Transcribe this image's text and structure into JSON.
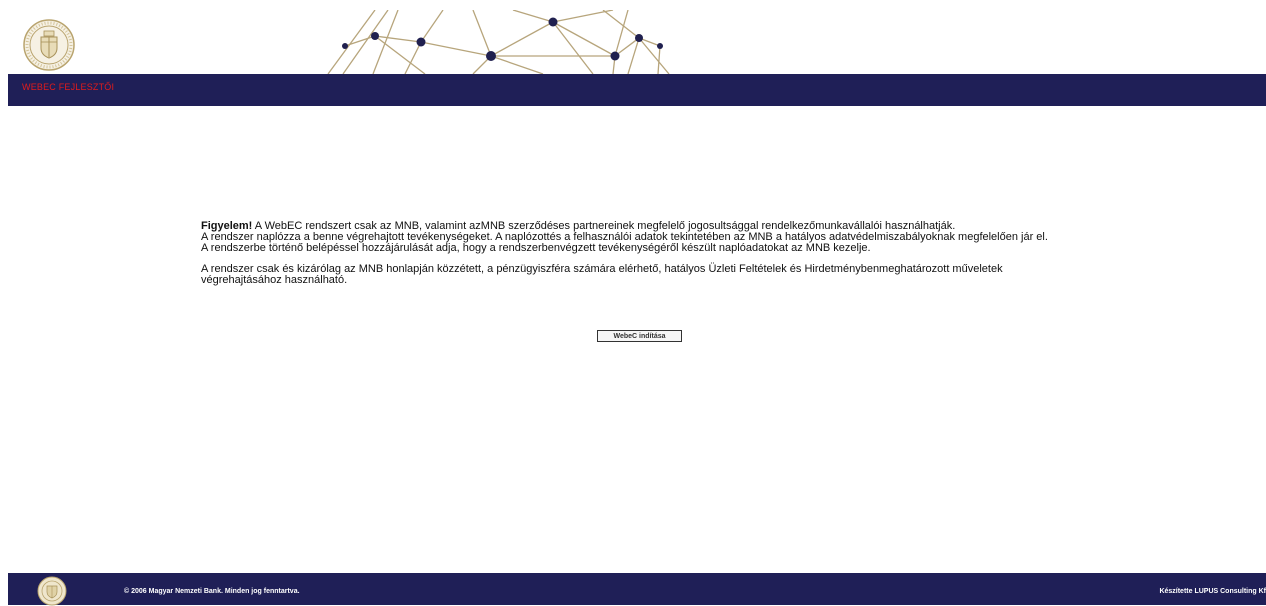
{
  "header": {
    "logo_icon": "mnb-seal-icon",
    "decoration_icon": "network-graph-icon"
  },
  "nav": {
    "title": "WEBEC FEJLESZTŐI",
    "title_color": "#e21b1b",
    "bar_color": "#1f1f57"
  },
  "notice": {
    "lead": "Figyelem!",
    "line1": " A WebEC rendszert csak az MNB, valamint azMNB szerződéses partnereinek megfelelő jogosultsággal rendelkezőmunkavállalói használhatják.",
    "line2": "A rendszer naplózza a benne végrehajtott tevékenységeket. A naplózottés a felhasználói adatok tekintetében az MNB a hatályos adatvédelmiszabályoknak megfelelően jár el.",
    "line3": "A rendszerbe történő belépéssel hozzájárulását adja, hogy a rendszerbenvégzett tevékenységéről készült naplóadatokat az MNB kezelje.",
    "line4": "A rendszer csak és kizárólag az MNB honlapján közzétett, a pénzügyiszféra számára elérhető, hatályos Üzleti Feltételek és Hirdetménybenmeghatározott műveletek végrehajtásához használható."
  },
  "launch_button": {
    "label": "WebeC indítása"
  },
  "footer": {
    "logo_icon": "mnb-seal-icon",
    "copyright": "© 2006 Magyar Nemzeti Bank. Minden jog fenntartva.",
    "credit": "Készítette LUPUS Consulting Kf"
  }
}
